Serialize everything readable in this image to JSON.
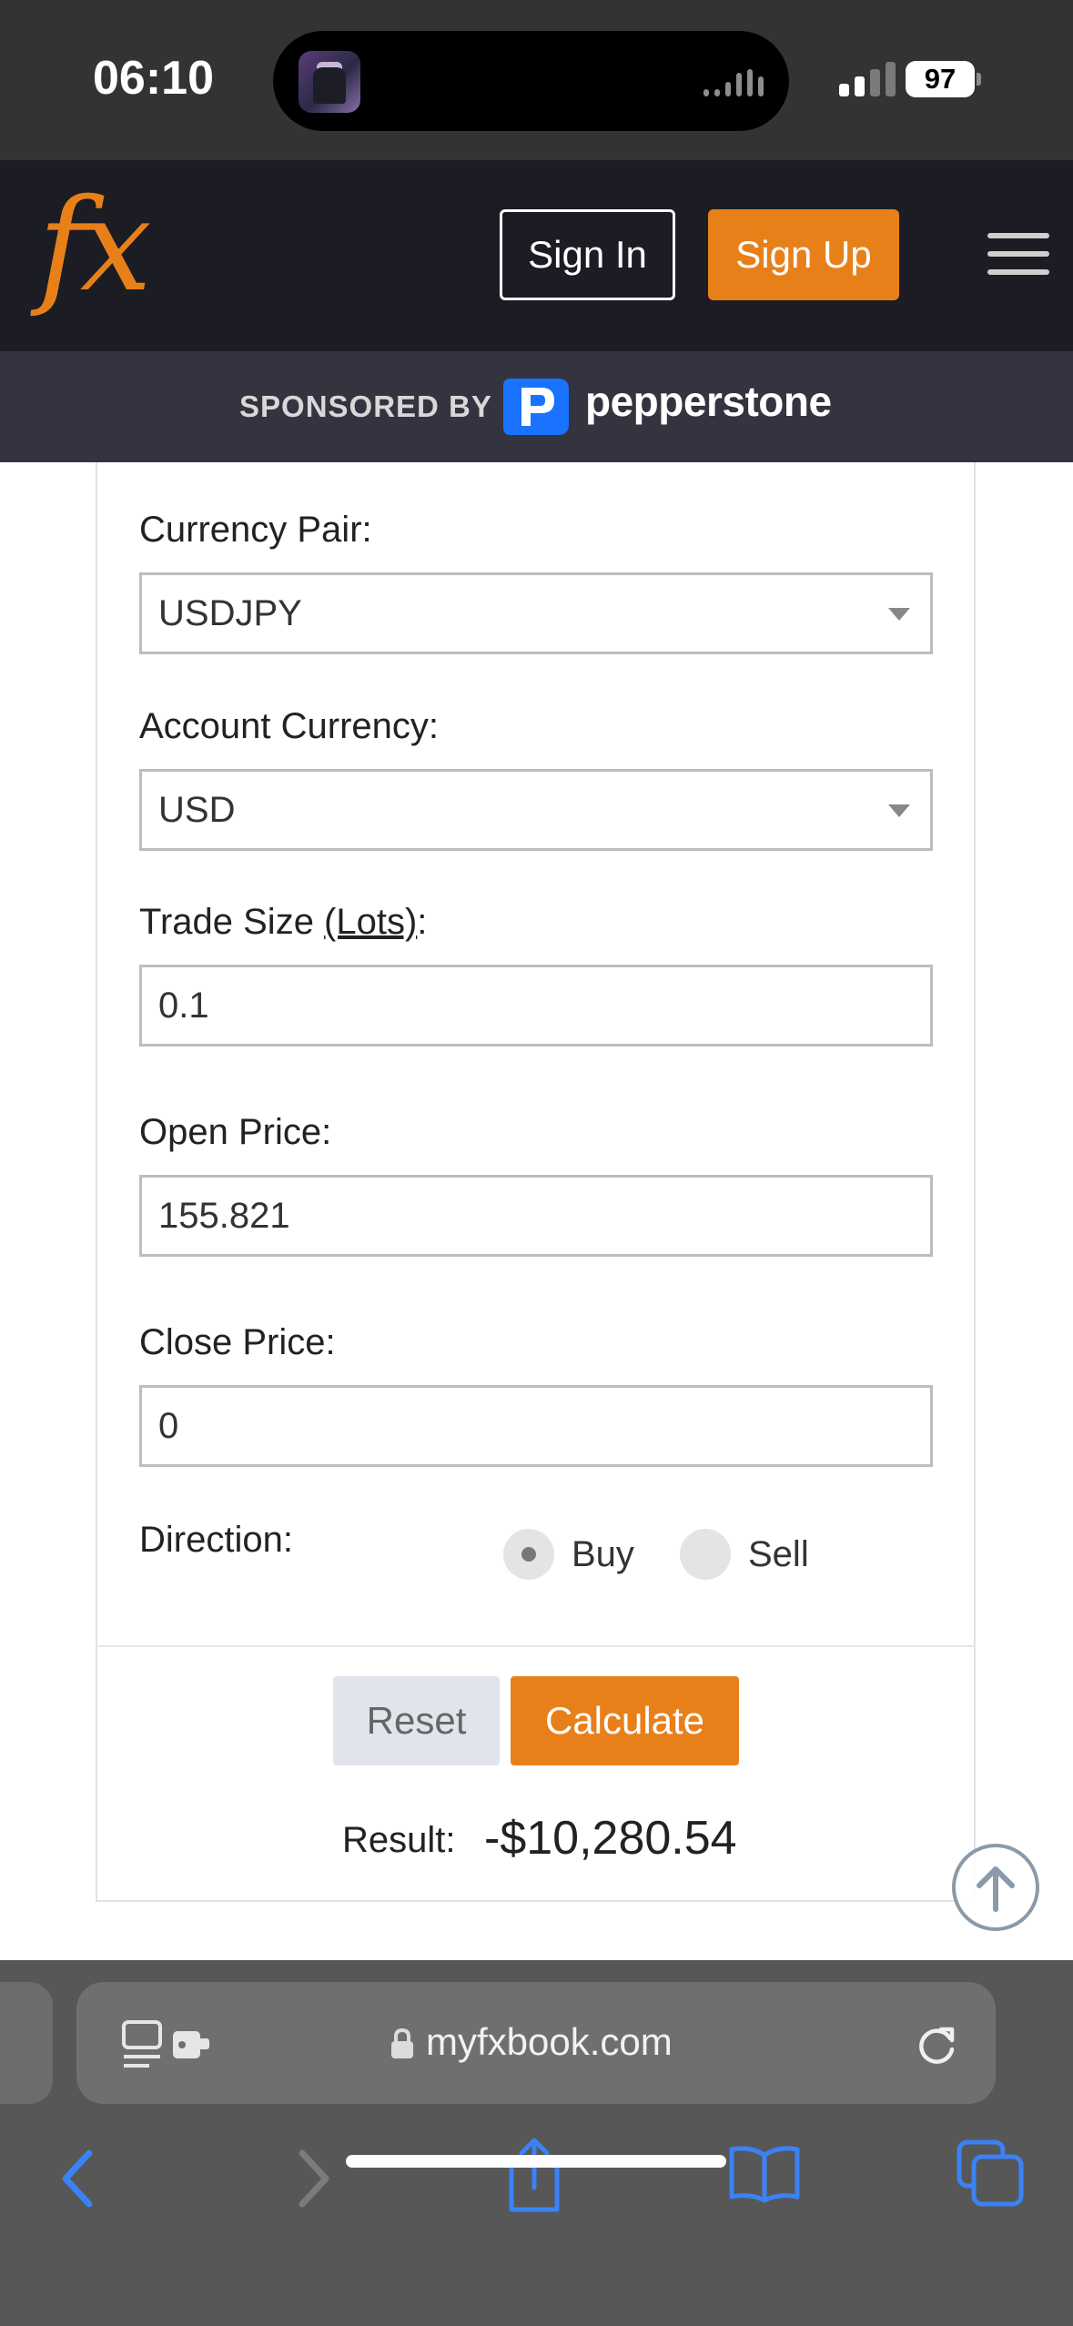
{
  "status_bar": {
    "time": "06:10",
    "battery": "97"
  },
  "header": {
    "logo": "fx",
    "sign_in": "Sign In",
    "sign_up": "Sign Up",
    "menu_icon": "hamburger-icon"
  },
  "sponsor": {
    "text": "SPONSORED BY",
    "brand": "pepperstone"
  },
  "form": {
    "currency_pair": {
      "label": "Currency Pair:",
      "value": "USDJPY"
    },
    "account_currency": {
      "label": "Account Currency:",
      "value": "USD"
    },
    "trade_size": {
      "label_prefix": "Trade Size ",
      "label_link": "(Lots)",
      "label_suffix": ":",
      "value": "0.1"
    },
    "open_price": {
      "label": "Open Price:",
      "value": "155.821"
    },
    "close_price": {
      "label": "Close Price:",
      "value": "0"
    },
    "direction": {
      "label": "Direction:",
      "options": [
        "Buy",
        "Sell"
      ],
      "selected": "Buy"
    },
    "reset": "Reset",
    "calculate": "Calculate",
    "result_label": "Result:",
    "result_value": "-$10,280.54"
  },
  "browser": {
    "url": "myfxbook.com"
  },
  "colors": {
    "accent": "#e8801a",
    "header_bg": "#1c1c24",
    "sponsor_bg": "#33343f",
    "ios_blue": "#3b82f6"
  }
}
